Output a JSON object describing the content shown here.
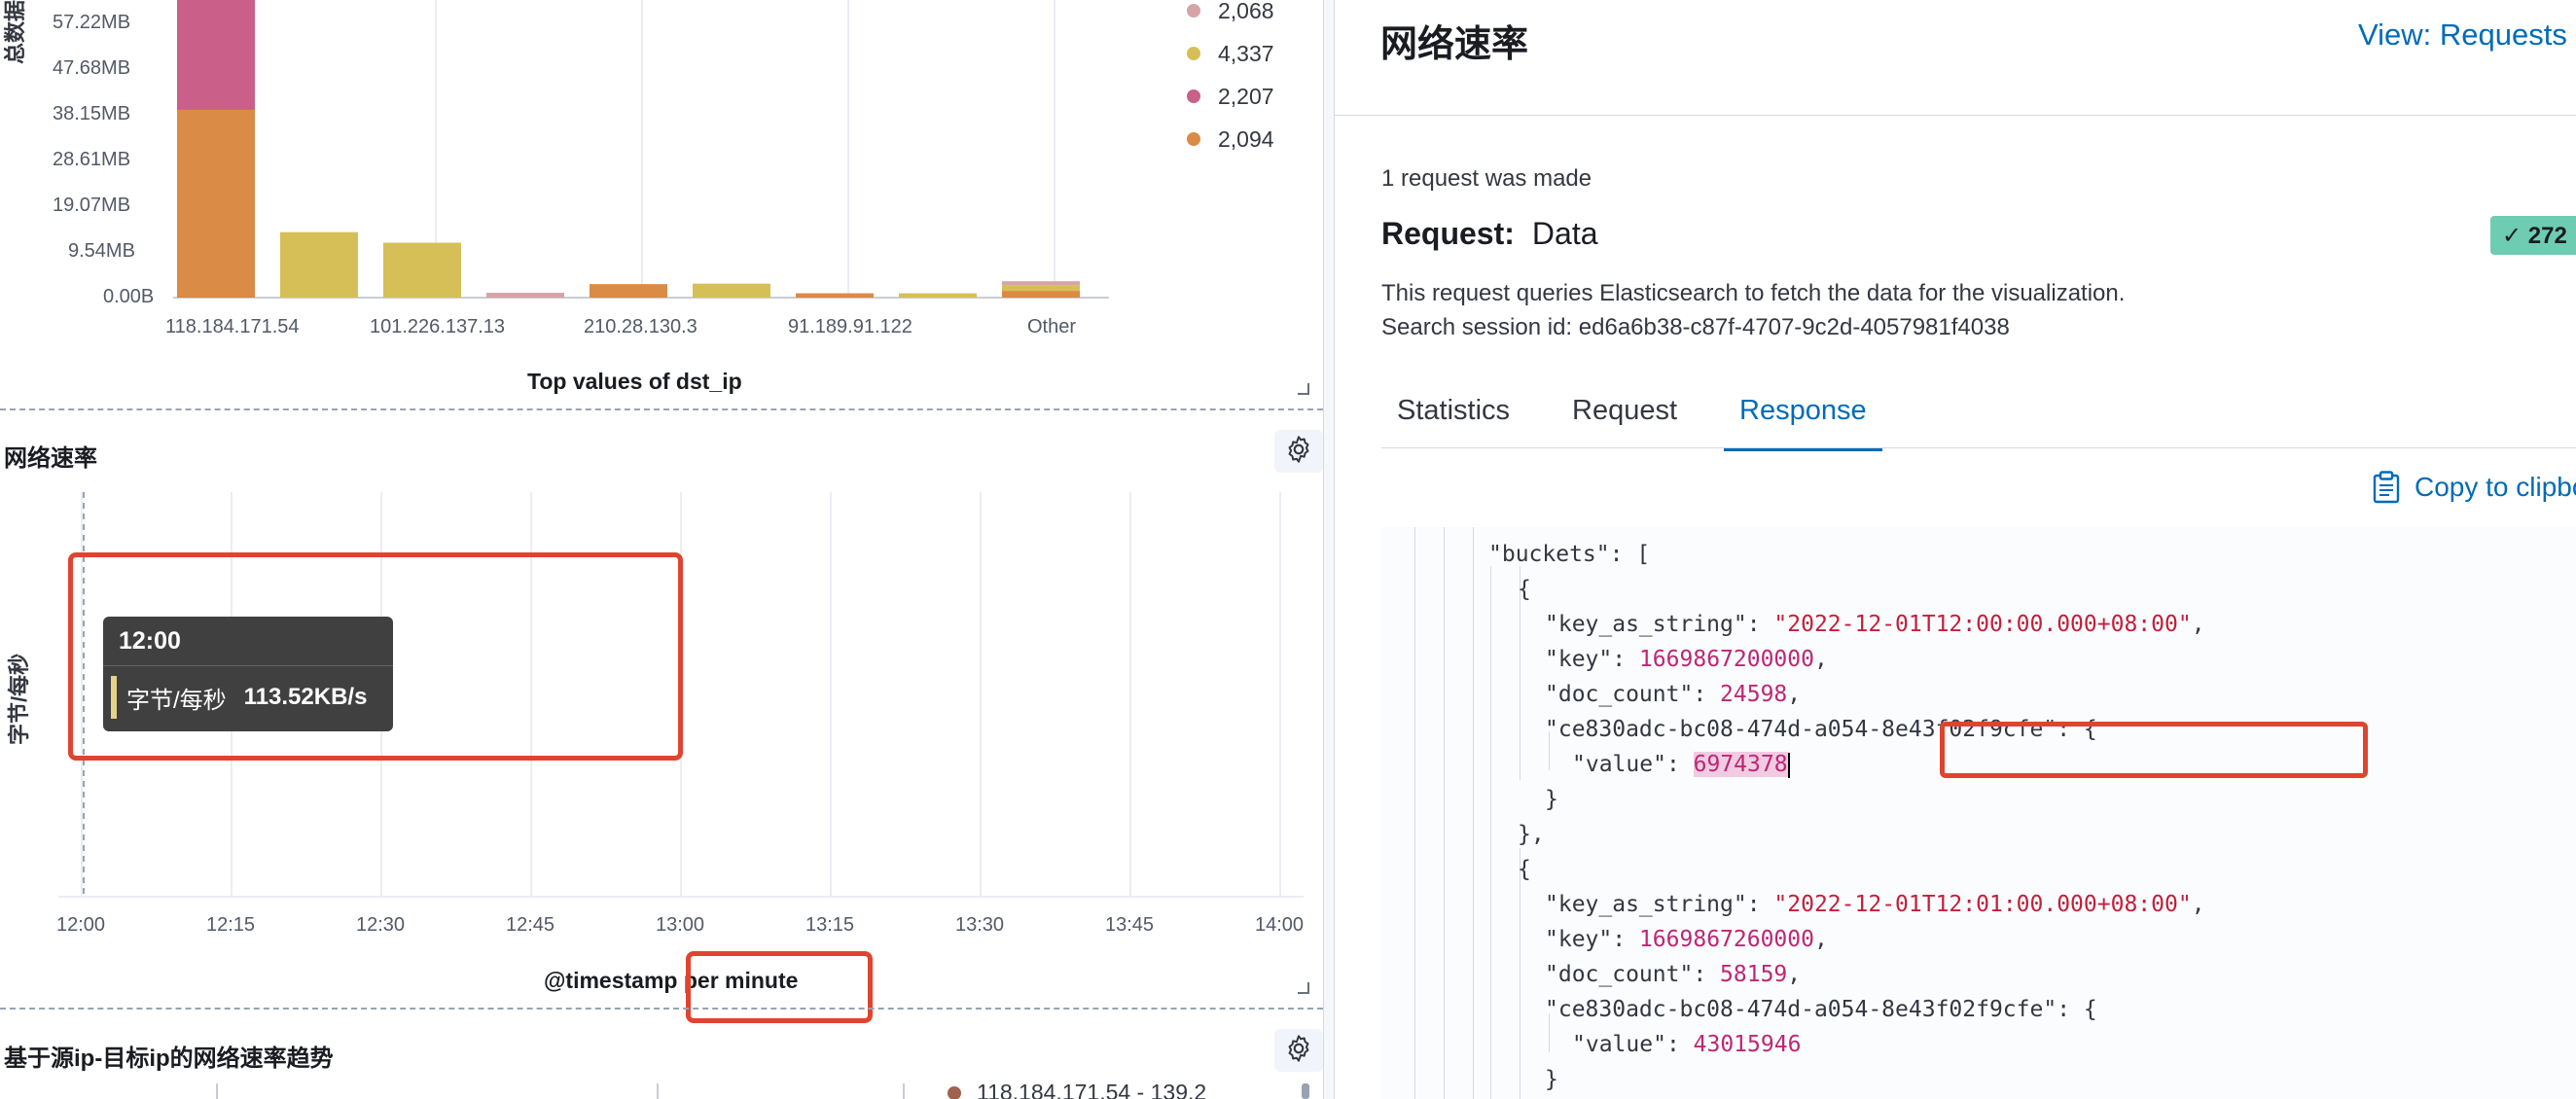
{
  "top_chart": {
    "yaxis_label": "总数据",
    "y_ticks": [
      "57.22MB",
      "47.68MB",
      "38.15MB",
      "28.61MB",
      "19.07MB",
      "9.54MB",
      "0.00B"
    ],
    "x_ticks": [
      "118.184.171.54",
      "101.226.137.13",
      "210.28.130.3",
      "91.189.91.122",
      "Other"
    ],
    "x_title": "Top values of dst_ip",
    "legend": [
      {
        "value": "2,068",
        "color": "#d6a4a8"
      },
      {
        "value": "4,337",
        "color": "#d6bf57"
      },
      {
        "value": "2,207",
        "color": "#ca5f8a"
      },
      {
        "value": "2,094",
        "color": "#da8b45"
      }
    ]
  },
  "chart_data": [
    {
      "type": "bar",
      "stacked": true,
      "unit": "MB",
      "categories": [
        "118.184.171.54",
        "",
        "101.226.137.13",
        "",
        "210.28.130.3",
        "",
        "91.189.91.122",
        "",
        "Other"
      ],
      "series": [
        {
          "color": "#da8b45",
          "values": [
            39,
            0,
            0,
            0,
            2.8,
            0,
            0.9,
            0,
            1.4
          ]
        },
        {
          "color": "#d6bf57",
          "values": [
            0,
            13.6,
            11.4,
            0,
            0,
            2.9,
            0,
            0.9,
            1.2
          ]
        },
        {
          "color": "#ca5f8a",
          "values": [
            23,
            0,
            0,
            0,
            0,
            0,
            0,
            0,
            0
          ]
        },
        {
          "color": "#d6a4a8",
          "values": [
            0,
            0,
            0,
            1.0,
            0,
            0,
            0,
            0,
            0.8
          ]
        }
      ],
      "x_title": "Top values of dst_ip",
      "ylim": [
        0,
        60
      ]
    },
    {
      "type": "line",
      "title": "网络速率",
      "y_label": "字节/每秒",
      "x_ticks": [
        "12:00",
        "12:15",
        "12:30",
        "12:45",
        "13:00",
        "13:15",
        "13:30",
        "13:45",
        "14:00"
      ],
      "x_title": "@timestamp per minute",
      "points": [
        {
          "x": "12:00",
          "y": 113.52,
          "unit": "KB/s"
        }
      ],
      "grid": true
    }
  ],
  "mid_panel": {
    "title": "网络速率",
    "yaxis_label": "字节/每秒",
    "x_ticks": [
      "12:00",
      "12:15",
      "12:30",
      "12:45",
      "13:00",
      "13:15",
      "13:30",
      "13:45",
      "14:00"
    ],
    "x_title": "@timestamp per minute",
    "tooltip": {
      "time": "12:00",
      "label": "字节/每秒",
      "value": "113.52KB/s"
    }
  },
  "bottom_panel": {
    "title": "基于源ip-目标ip的网络速率趋势",
    "legend_text": "118.184.171.54 - 139.2"
  },
  "flyout": {
    "title": "网络速率",
    "view_link": "View: Requests",
    "request_count": "1 request was made",
    "request_label": "Request:",
    "request_name": "Data",
    "status_badge": "✓ 272",
    "description": "This request queries Elasticsearch to fetch the data for the visualization.",
    "session": "Search session id: ed6a6b38-c87f-4707-9c2d-4057981f4038",
    "tabs": [
      "Statistics",
      "Request",
      "Response"
    ],
    "active_tab": "Response",
    "copy_label": "Copy to clipboard"
  },
  "response_json": {
    "buckets_key": "\"buckets\"",
    "bucket1": {
      "key_as_string": "\"2022-12-01T12:00:00.000+08:00\"",
      "key": "1669867200000",
      "doc_count": "24598",
      "agg_key": "\"ce830adc-bc08-474d-a054-8e43f02f9cfe\"",
      "value": "6974378"
    },
    "bucket2": {
      "key_as_string": "\"2022-12-01T12:01:00.000+08:00\"",
      "key": "1669867260000",
      "doc_count": "58159",
      "agg_key": "\"ce830adc-bc08-474d-a054-8e43f02f9cfe\"",
      "value": "43015946"
    }
  }
}
